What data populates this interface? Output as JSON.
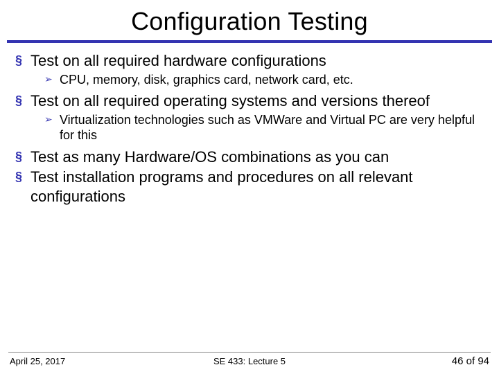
{
  "title": "Configuration Testing",
  "items": [
    {
      "text": "Test on all required hardware configurations",
      "sub": [
        "CPU, memory, disk, graphics card, network card, etc."
      ]
    },
    {
      "text": "Test on all required operating systems and versions thereof",
      "sub": [
        "Virtualization technologies such as VMWare and Virtual PC are very helpful for this"
      ]
    },
    {
      "text": "Test as many Hardware/OS combinations as you can",
      "sub": []
    },
    {
      "text": "Test installation programs and procedures on all relevant configurations",
      "sub": []
    }
  ],
  "footer": {
    "date": "April 25, 2017",
    "center": "SE 433: Lecture 5",
    "page": "46 of 94"
  }
}
